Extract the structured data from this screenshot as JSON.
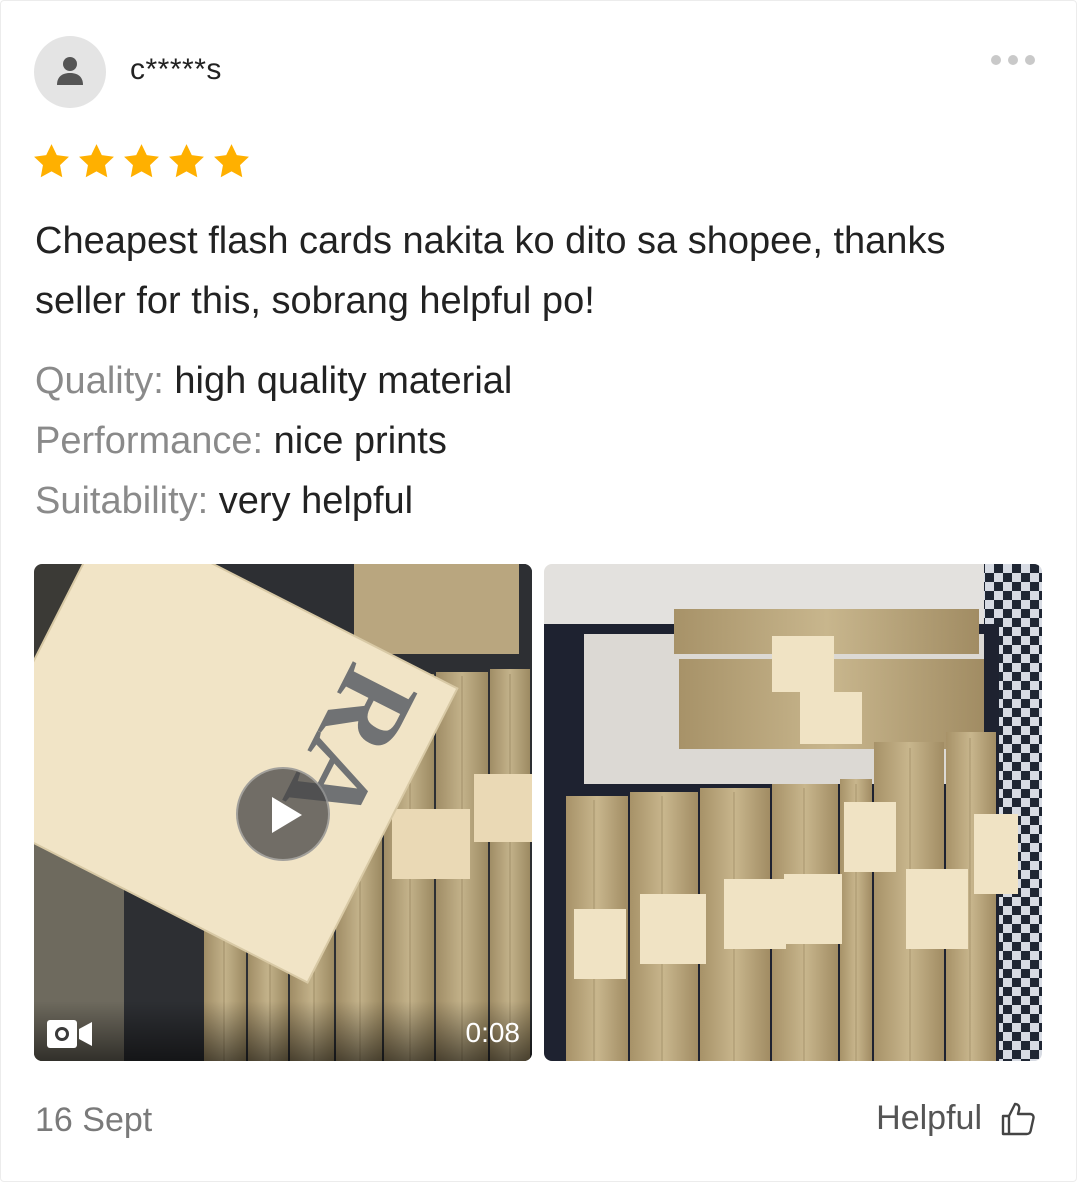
{
  "review": {
    "username": "c*****s",
    "rating": 5,
    "star_color": "#ffb000",
    "comment": "Cheapest flash cards nakita ko dito sa shopee, thanks seller for this, sobrang helpful po!",
    "attributes": [
      {
        "key": "Quality:",
        "value": "high quality material"
      },
      {
        "key": "Performance:",
        "value": "nice prints"
      },
      {
        "key": "Suitability:",
        "value": "very helpful"
      }
    ],
    "media": {
      "video_duration": "0:08",
      "video_icon": "video-camera-icon",
      "play_icon": "play-icon",
      "video_text": "RA"
    },
    "date": "16 Sept",
    "helpful_label": "Helpful",
    "more_icon": "more-dots-icon",
    "helpful_icon": "thumbs-up-icon"
  }
}
